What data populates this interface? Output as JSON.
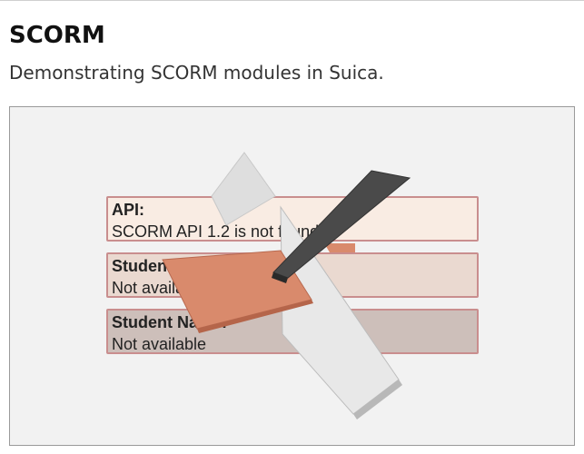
{
  "page": {
    "title": "SCORM",
    "subtitle": "Demonstrating SCORM modules in Suica."
  },
  "panels": [
    {
      "heading": "API:",
      "value": "SCORM API 1.2 is not found"
    },
    {
      "heading": "Student ID:",
      "value": "Not available"
    },
    {
      "heading": "Student Name:",
      "value": "Not available"
    }
  ],
  "scene": {
    "colors": {
      "background": "#f2f2f2",
      "panel_border": "#c98e8e",
      "orange_plate": "#d9876a",
      "dark_plate": "#4a4a4a",
      "white_plate": "#e4e4e4"
    }
  }
}
